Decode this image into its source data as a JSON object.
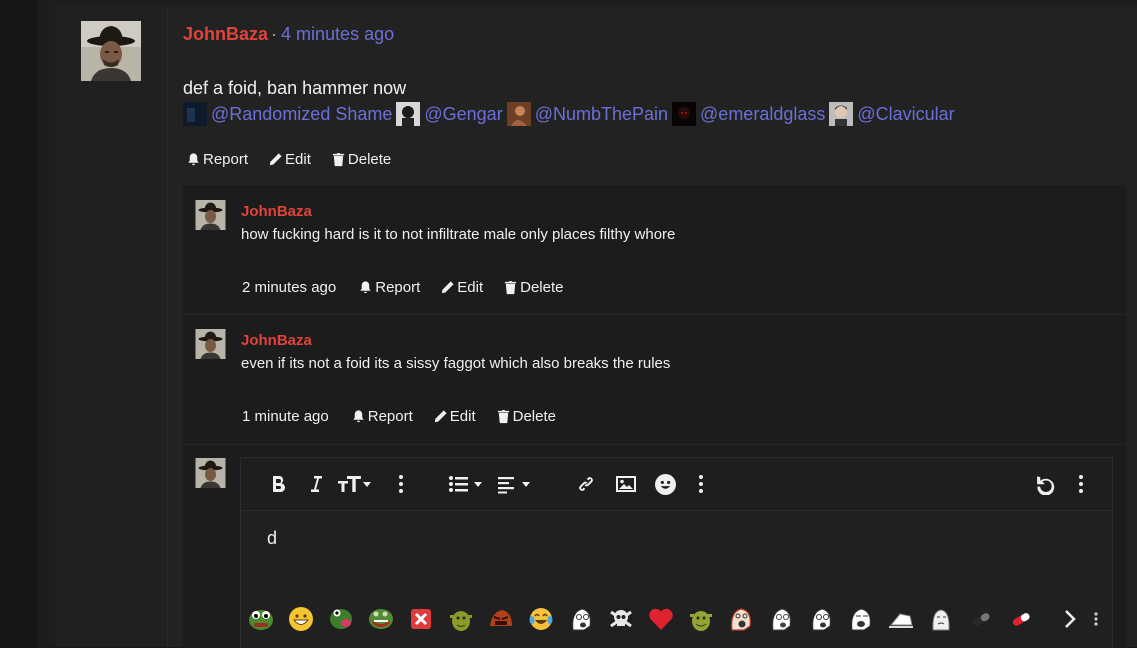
{
  "post": {
    "author": "JohnBaza",
    "separator": "·",
    "time": "4 minutes ago",
    "body": "def a foid, ban hammer now",
    "mentions": [
      {
        "label": "@Randomized Shame"
      },
      {
        "label": "@Gengar"
      },
      {
        "label": "@NumbThePain"
      },
      {
        "label": "@emeraldglass"
      },
      {
        "label": "@Clavicular"
      }
    ],
    "actions": {
      "report": "Report",
      "edit": "Edit",
      "delete": "Delete"
    }
  },
  "replies": [
    {
      "author": "JohnBaza",
      "text": "how fucking hard is it to not infiltrate male only places filthy whore",
      "time": "2 minutes ago",
      "actions": {
        "report": "Report",
        "edit": "Edit",
        "delete": "Delete"
      }
    },
    {
      "author": "JohnBaza",
      "text": "even if its not a foid its a sissy faggot which also breaks the rules",
      "time": "1 minute ago",
      "actions": {
        "report": "Report",
        "edit": "Edit",
        "delete": "Delete"
      }
    }
  ],
  "editor": {
    "content": "d",
    "toolbar": [
      "bold-icon",
      "italic-icon",
      "text-size-icon",
      "more-vertical-icon",
      "list-icon",
      "align-icon",
      "link-icon",
      "image-icon",
      "smiley-icon",
      "more-vertical-icon",
      "undo-icon",
      "more-vertical-icon"
    ],
    "emojis": [
      "pepe-frog",
      "grin-face",
      "frog-tongue",
      "pepe-grin",
      "x-mark",
      "shrek",
      "angry-red",
      "laugh-cry",
      "soyjak",
      "skull-crossbones",
      "red-heart",
      "shrek-small",
      "soyjak-scream",
      "soyjak-sketch",
      "soyjak-point",
      "soyjak-drawing",
      "laying-doodle",
      "wojak",
      "black-pill",
      "red-pill",
      "next-arrow"
    ]
  },
  "colors": {
    "username": "#e0433a",
    "link": "#6b70d6",
    "background": "#191919"
  }
}
